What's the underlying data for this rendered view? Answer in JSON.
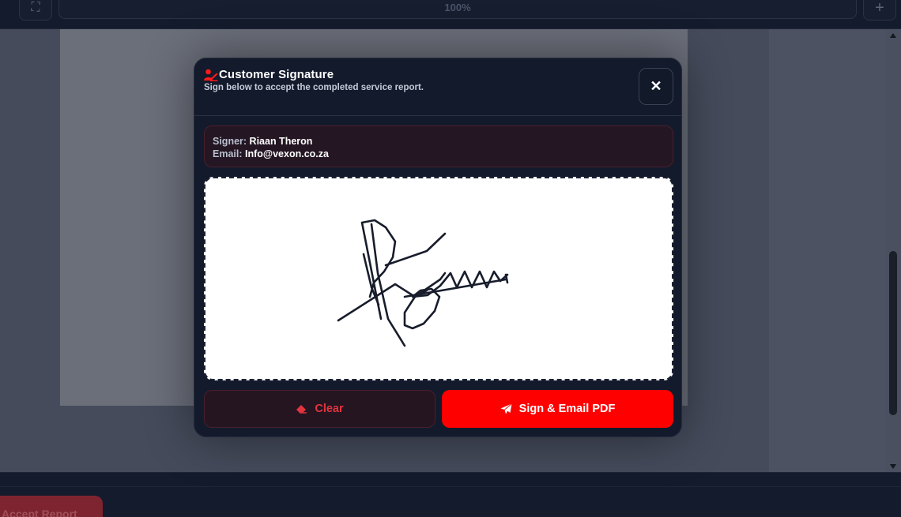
{
  "toolbar": {
    "zoom": "100%",
    "expand_icon": "expand-icon",
    "plus_icon": "plus-icon"
  },
  "modal": {
    "title": "Customer Signature",
    "subtitle": "Sign below to accept the completed service report.",
    "title_icon": "user-signature-icon",
    "close_icon": "close-icon",
    "signer": {
      "signer_label": "Signer:",
      "signer_name": "Riaan Theron",
      "email_label": "Email:",
      "email": "Info@vexon.co.za"
    },
    "buttons": {
      "clear_label": "Clear",
      "clear_icon": "eraser-icon",
      "send_label": "Sign & Email PDF",
      "send_icon": "paper-plane-icon"
    }
  },
  "bottombar": {
    "accept_label": "Accept Report"
  },
  "colors": {
    "accent": "#ff0000",
    "background": "#131a2b",
    "clear_text": "#e2343f"
  }
}
